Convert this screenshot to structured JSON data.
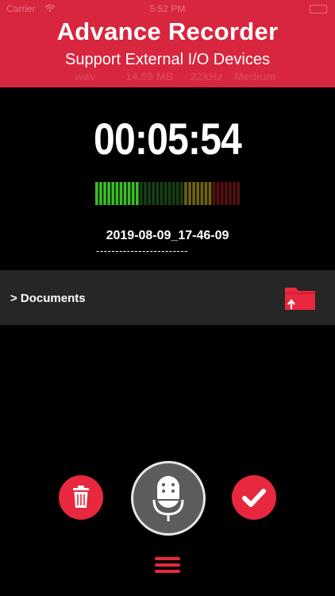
{
  "status_bar": {
    "carrier": "Carrier",
    "time": "5:52 PM"
  },
  "banner": {
    "title": "Advance Recorder",
    "subtitle": "Support External I/O Devices",
    "ghost_info": [
      "wav",
      "14.89 MB",
      "22kHz",
      "Medium"
    ]
  },
  "recorder": {
    "timer": "00:05:54",
    "filename": "2019-08-09_17-46-09",
    "filename_underline": "------------------------",
    "level": 0.3
  },
  "folder": {
    "path": "> Documents"
  },
  "icons": {
    "delete": "trash-icon",
    "record": "microphone-icon",
    "confirm": "checkmark-icon",
    "folder": "folder-upload-icon",
    "menu": "hamburger-menu-icon"
  },
  "colors": {
    "accent": "#d8263e",
    "button": "#e8283e",
    "meter_green": "#3dbb2a",
    "meter_yellow": "#8a7a16",
    "meter_red": "#6a1414",
    "panel": "#262626"
  }
}
